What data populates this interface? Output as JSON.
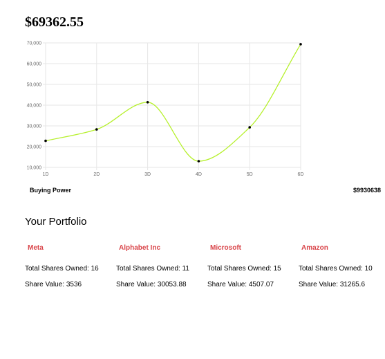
{
  "account": {
    "total_value": "$69362.55",
    "buying_power_label": "Buying Power",
    "buying_power_value": "$9930638"
  },
  "portfolio": {
    "title": "Your Portfolio",
    "holdings": [
      {
        "name": "Meta",
        "shares": "Total Shares Owned: 16",
        "value": "Share Value: 3536"
      },
      {
        "name": "Alphabet Inc",
        "shares": "Total Shares Owned: 11",
        "value": "Share Value: 30053.88"
      },
      {
        "name": "Microsoft",
        "shares": "Total Shares Owned: 15",
        "value": "Share Value: 4507.07"
      },
      {
        "name": "Amazon",
        "shares": "Total Shares Owned: 10",
        "value": "Share Value: 31265.6"
      }
    ]
  },
  "colors": {
    "line": "#b6f02c",
    "points": "#000000",
    "holding_name": "#d9454a",
    "grid": "#e6e6e6"
  },
  "chart_data": {
    "type": "line",
    "categories": [
      "1D",
      "2D",
      "3D",
      "4D",
      "5D",
      "6D"
    ],
    "series": [
      {
        "values": [
          22800,
          28300,
          41400,
          13000,
          29300,
          69362.55
        ]
      }
    ],
    "ylim": [
      10000,
      70000
    ],
    "yticks": [
      10000,
      20000,
      30000,
      40000,
      50000,
      60000,
      70000
    ],
    "ytick_labels": [
      "10,000",
      "20,000",
      "30,000",
      "40,000",
      "50,000",
      "60,000",
      "70,000"
    ],
    "grid": true,
    "legend": "none"
  }
}
